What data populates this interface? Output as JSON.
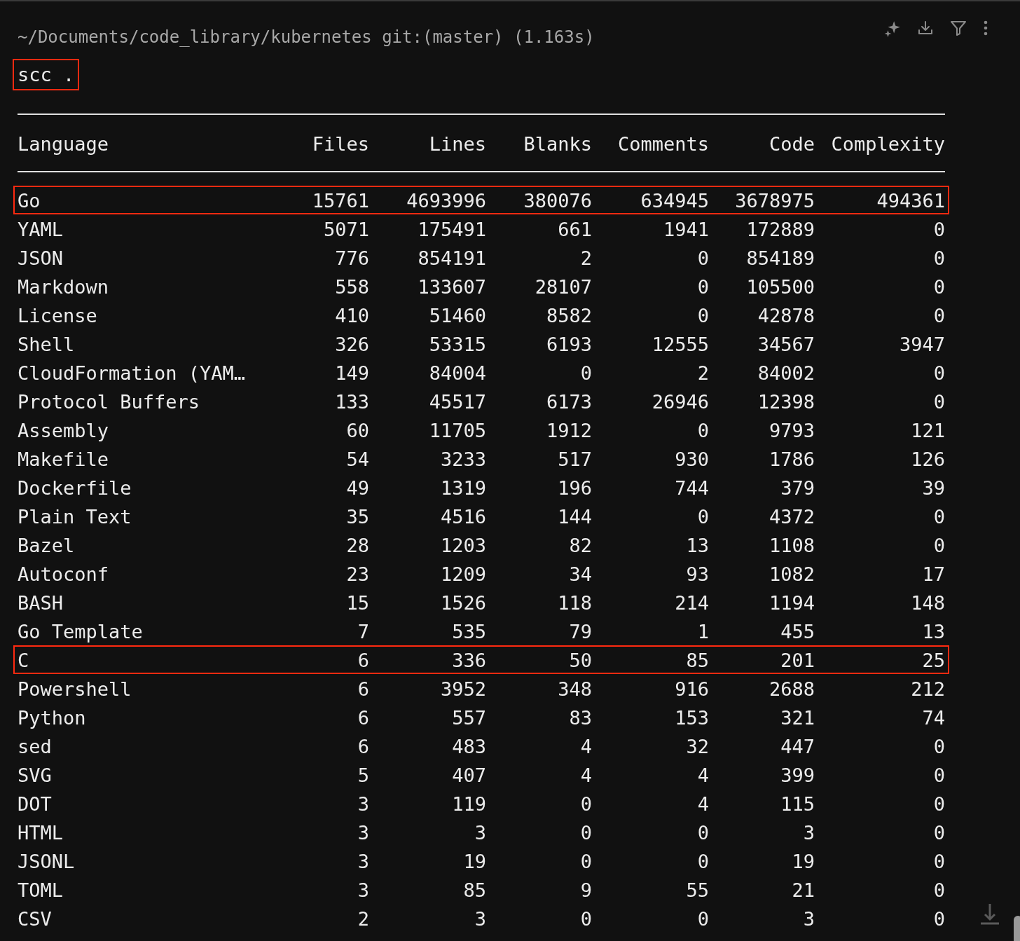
{
  "prompt": "~/Documents/code_library/kubernetes git:(master) (1.163s)",
  "command": {
    "text": "scc .",
    "highlighted": true
  },
  "table": {
    "columns": [
      "Language",
      "Files",
      "Lines",
      "Blanks",
      "Comments",
      "Code",
      "Complexity"
    ],
    "rows": [
      {
        "cells": [
          "Go",
          "15761",
          "4693996",
          "380076",
          "634945",
          "3678975",
          "494361"
        ],
        "highlighted": true
      },
      {
        "cells": [
          "YAML",
          "5071",
          "175491",
          "661",
          "1941",
          "172889",
          "0"
        ],
        "highlighted": false
      },
      {
        "cells": [
          "JSON",
          "776",
          "854191",
          "2",
          "0",
          "854189",
          "0"
        ],
        "highlighted": false
      },
      {
        "cells": [
          "Markdown",
          "558",
          "133607",
          "28107",
          "0",
          "105500",
          "0"
        ],
        "highlighted": false
      },
      {
        "cells": [
          "License",
          "410",
          "51460",
          "8582",
          "0",
          "42878",
          "0"
        ],
        "highlighted": false
      },
      {
        "cells": [
          "Shell",
          "326",
          "53315",
          "6193",
          "12555",
          "34567",
          "3947"
        ],
        "highlighted": false
      },
      {
        "cells": [
          "CloudFormation (YAM…",
          "149",
          "84004",
          "0",
          "2",
          "84002",
          "0"
        ],
        "highlighted": false
      },
      {
        "cells": [
          "Protocol Buffers",
          "133",
          "45517",
          "6173",
          "26946",
          "12398",
          "0"
        ],
        "highlighted": false
      },
      {
        "cells": [
          "Assembly",
          "60",
          "11705",
          "1912",
          "0",
          "9793",
          "121"
        ],
        "highlighted": false
      },
      {
        "cells": [
          "Makefile",
          "54",
          "3233",
          "517",
          "930",
          "1786",
          "126"
        ],
        "highlighted": false
      },
      {
        "cells": [
          "Dockerfile",
          "49",
          "1319",
          "196",
          "744",
          "379",
          "39"
        ],
        "highlighted": false
      },
      {
        "cells": [
          "Plain Text",
          "35",
          "4516",
          "144",
          "0",
          "4372",
          "0"
        ],
        "highlighted": false
      },
      {
        "cells": [
          "Bazel",
          "28",
          "1203",
          "82",
          "13",
          "1108",
          "0"
        ],
        "highlighted": false
      },
      {
        "cells": [
          "Autoconf",
          "23",
          "1209",
          "34",
          "93",
          "1082",
          "17"
        ],
        "highlighted": false
      },
      {
        "cells": [
          "BASH",
          "15",
          "1526",
          "118",
          "214",
          "1194",
          "148"
        ],
        "highlighted": false
      },
      {
        "cells": [
          "Go Template",
          "7",
          "535",
          "79",
          "1",
          "455",
          "13"
        ],
        "highlighted": false
      },
      {
        "cells": [
          "C",
          "6",
          "336",
          "50",
          "85",
          "201",
          "25"
        ],
        "highlighted": true
      },
      {
        "cells": [
          "Powershell",
          "6",
          "3952",
          "348",
          "916",
          "2688",
          "212"
        ],
        "highlighted": false
      },
      {
        "cells": [
          "Python",
          "6",
          "557",
          "83",
          "153",
          "321",
          "74"
        ],
        "highlighted": false
      },
      {
        "cells": [
          "sed",
          "6",
          "483",
          "4",
          "32",
          "447",
          "0"
        ],
        "highlighted": false
      },
      {
        "cells": [
          "SVG",
          "5",
          "407",
          "4",
          "4",
          "399",
          "0"
        ],
        "highlighted": false
      },
      {
        "cells": [
          "DOT",
          "3",
          "119",
          "0",
          "4",
          "115",
          "0"
        ],
        "highlighted": false
      },
      {
        "cells": [
          "HTML",
          "3",
          "3",
          "0",
          "0",
          "3",
          "0"
        ],
        "highlighted": false
      },
      {
        "cells": [
          "JSONL",
          "3",
          "19",
          "0",
          "0",
          "19",
          "0"
        ],
        "highlighted": false
      },
      {
        "cells": [
          "TOML",
          "3",
          "85",
          "9",
          "55",
          "21",
          "0"
        ],
        "highlighted": false
      },
      {
        "cells": [
          "CSV",
          "2",
          "3",
          "0",
          "0",
          "3",
          "0"
        ],
        "highlighted": false
      }
    ]
  }
}
